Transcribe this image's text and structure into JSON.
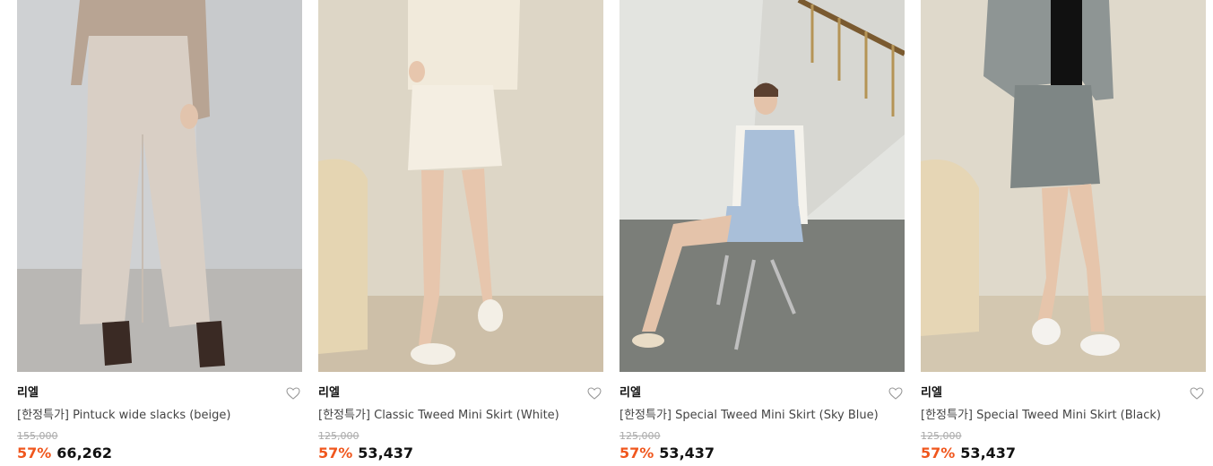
{
  "products": [
    {
      "brand": "리엘",
      "title": "[한정특가] Pintuck wide slacks (beige)",
      "original_price": "155,000",
      "discount": "57%",
      "price": "66,262",
      "image_alt": "model wearing beige wide slacks"
    },
    {
      "brand": "리엘",
      "title": "[한정특가] Classic Tweed Mini Skirt (White)",
      "original_price": "125,000",
      "discount": "57%",
      "price": "53,437",
      "image_alt": "model wearing white tweed mini skirt"
    },
    {
      "brand": "리엘",
      "title": "[한정특가] Special Tweed Mini Skirt (Sky Blue)",
      "original_price": "125,000",
      "discount": "57%",
      "price": "53,437",
      "image_alt": "model seated in sky blue tweed set"
    },
    {
      "brand": "리엘",
      "title": "[한정특가] Special Tweed Mini Skirt (Black)",
      "original_price": "125,000",
      "discount": "57%",
      "price": "53,437",
      "image_alt": "model wearing black tweed mini skirt"
    }
  ],
  "colors": {
    "discount": "#f0571e",
    "price": "#111111",
    "original_price": "#aaaaaa",
    "title": "#444444"
  },
  "icons": {
    "wish": "heart-outline-icon"
  }
}
